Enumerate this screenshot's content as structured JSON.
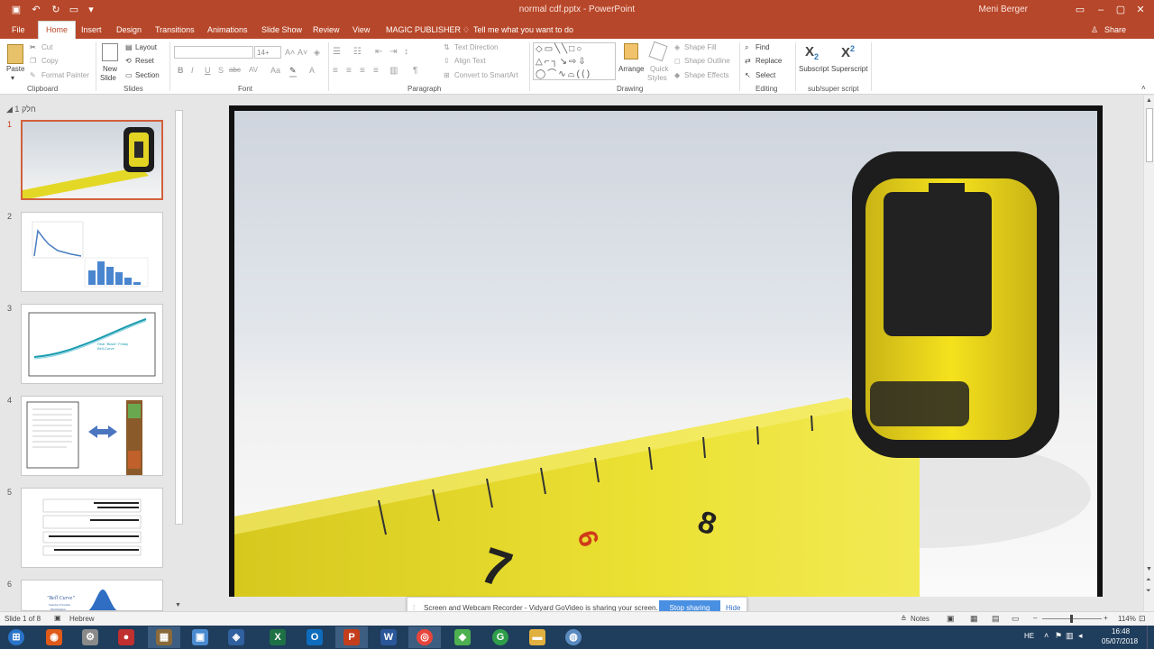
{
  "window": {
    "title": "normal cdf.pptx - PowerPoint",
    "user": "Meni Berger"
  },
  "qat": {
    "save_icon": "save-icon",
    "undo_icon": "undo-icon",
    "redo_icon": "redo-icon",
    "present_icon": "slideshow-icon"
  },
  "tabs": [
    "File",
    "Home",
    "Insert",
    "Design",
    "Transitions",
    "Animations",
    "Slide Show",
    "Review",
    "View",
    "MAGIC PUBLISHER"
  ],
  "tell_me": "Tell me what you want to do",
  "share": "Share",
  "ribbon": {
    "clipboard": {
      "paste": "Paste",
      "cut": "Cut",
      "copy": "Copy",
      "format_painter": "Format Painter",
      "label": "Clipboard"
    },
    "slides": {
      "new_slide": "New",
      "new_slide2": "Slide",
      "layout": "Layout",
      "reset": "Reset",
      "section": "Section",
      "label": "Slides"
    },
    "font": {
      "size": "14+",
      "label": "Font",
      "bold": "B",
      "italic": "I",
      "underline": "U",
      "shadow": "S",
      "strike": "abc",
      "spacing": "AV",
      "case": "Aa",
      "color": "A"
    },
    "paragraph": {
      "text_direction": "Text Direction",
      "align_text": "Align Text",
      "convert": "Convert to SmartArt",
      "label": "Paragraph"
    },
    "drawing": {
      "arrange": "Arrange",
      "quick": "Quick",
      "styles": "Styles",
      "fill": "Shape Fill",
      "outline": "Shape Outline",
      "effects": "Shape Effects",
      "label": "Drawing"
    },
    "editing": {
      "find": "Find",
      "replace": "Replace",
      "select": "Select",
      "label": "Editing"
    },
    "subsuper": {
      "subscript": "Subscript",
      "superscript": "Superscript",
      "label": "sub/super script",
      "sub_glyph": "X",
      "sub_num": "2",
      "sup_glyph": "X",
      "sup_num": "2"
    }
  },
  "panel": {
    "section": "חלק 1",
    "slide_numbers": [
      "1",
      "2",
      "3",
      "4",
      "5",
      "6"
    ]
  },
  "slide3": {
    "label1": "Real \"Black\" Friday",
    "label2": "Bell-Curve"
  },
  "slide6": {
    "title": "\"Bell Curve\"",
    "sub1": "Standard Normal",
    "sub2": "Distribution"
  },
  "slide1_marks": [
    "6",
    "7",
    "8"
  ],
  "status": {
    "slide": "Slide 1 of 8",
    "lang": "Hebrew",
    "notes": "Notes",
    "zoom": "114%"
  },
  "sharebar": {
    "text": "Screen and Webcam Recorder - Vidyard GoVideo is sharing your screen.",
    "stop": "Stop sharing",
    "hide": "Hide"
  },
  "taskbar": {
    "lang": "HE",
    "time": "16:48",
    "date": "05/07/2018"
  },
  "colors": {
    "accent": "#b7472a",
    "tape": "#e8dc2a",
    "stop": "#4a90e2"
  }
}
